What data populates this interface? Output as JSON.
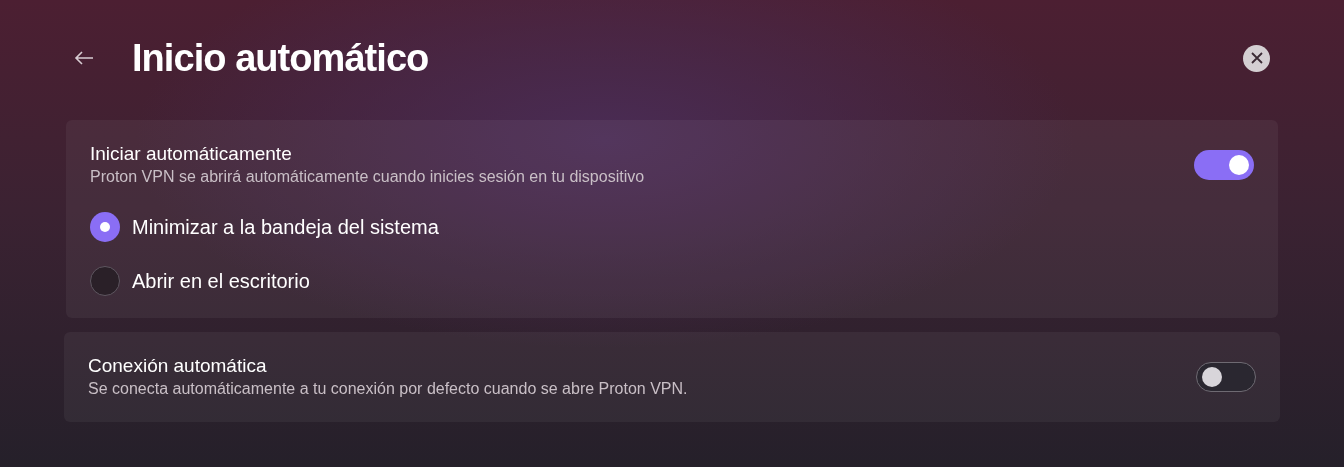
{
  "header": {
    "title": "Inicio automático"
  },
  "sections": [
    {
      "title": "Iniciar automáticamente",
      "description": "Proton VPN se abrirá automáticamente cuando inicies sesión en tu dispositivo",
      "on": true,
      "options": [
        {
          "label": "Minimizar a la bandeja del sistema",
          "selected": true
        },
        {
          "label": "Abrir en el escritorio",
          "selected": false
        }
      ]
    },
    {
      "title": "Conexión automática",
      "description": "Se conecta automáticamente a tu conexión por defecto cuando se abre Proton VPN.",
      "on": false
    }
  ]
}
